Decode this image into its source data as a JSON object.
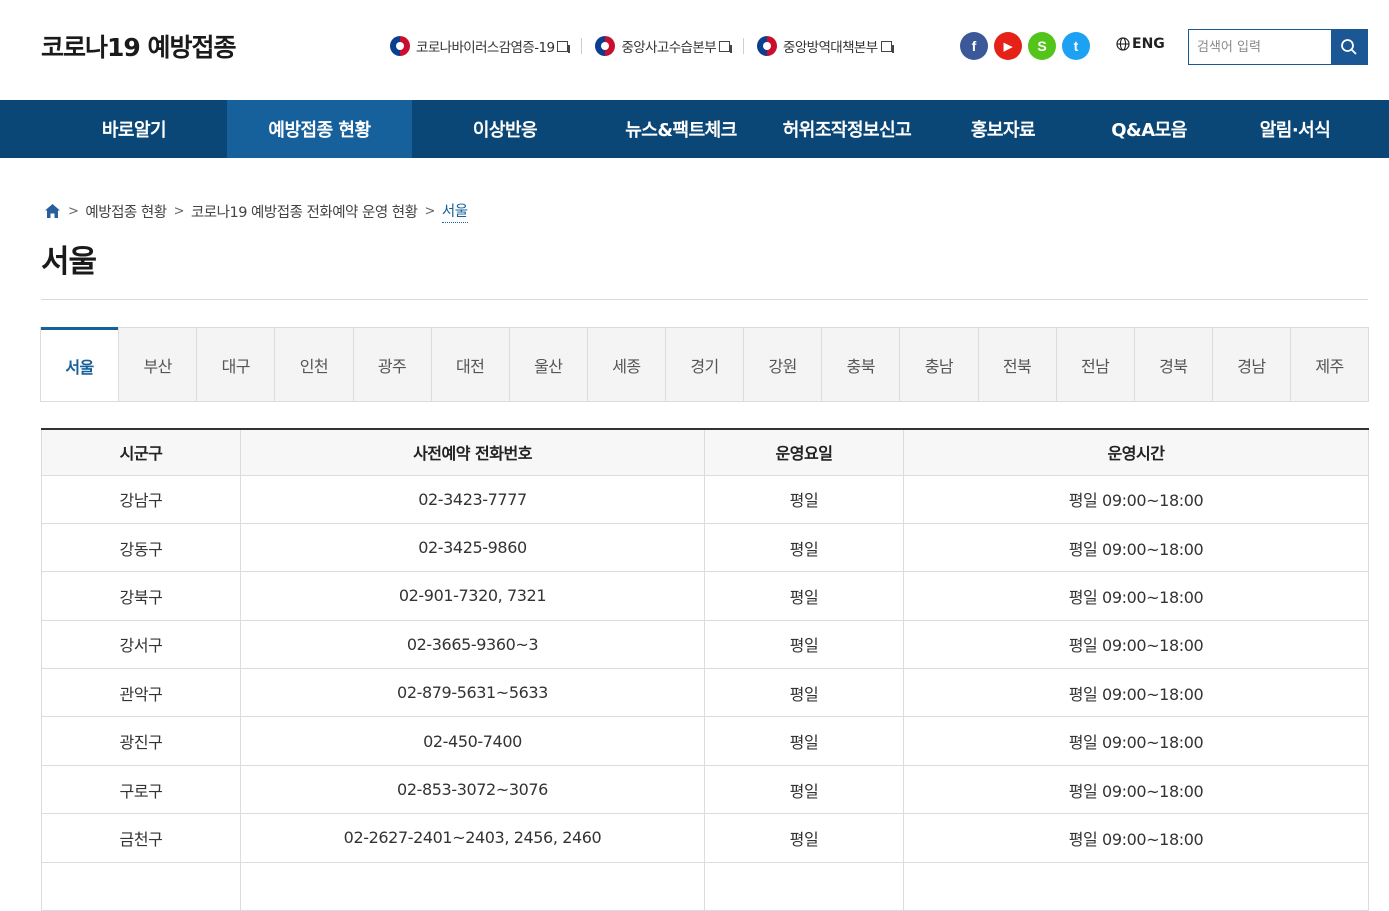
{
  "header": {
    "logo": "코로나19 예방접종",
    "util_links": [
      {
        "label": "코로나바이러스감염증-19"
      },
      {
        "label": "중앙사고수습본부"
      },
      {
        "label": "중앙방역대책본부"
      }
    ],
    "sns": [
      {
        "name": "facebook",
        "glyph": "f",
        "color": "#3b5998"
      },
      {
        "name": "youtube",
        "glyph": "▶",
        "color": "#e62117"
      },
      {
        "name": "kakaostory",
        "glyph": "S",
        "color": "#52c41a"
      },
      {
        "name": "twitter",
        "glyph": "t",
        "color": "#1da1f2"
      }
    ],
    "eng_label": "ENG",
    "search_placeholder": "검색어 입력"
  },
  "gnb": {
    "items": [
      {
        "label": "바로알기"
      },
      {
        "label": "예방접종 현황"
      },
      {
        "label": "이상반응"
      },
      {
        "label": "뉴스&팩트체크"
      },
      {
        "label": "허위조작정보신고"
      },
      {
        "label": "홍보자료"
      },
      {
        "label": "Q&A모음"
      },
      {
        "label": "알림·서식"
      }
    ],
    "active_index": 1
  },
  "breadcrumb": {
    "items": [
      "예방접종 현황",
      "코로나19 예방접종 전화예약 운영 현황"
    ],
    "current": "서울"
  },
  "page_title": "서울",
  "tabs": {
    "items": [
      "서울",
      "부산",
      "대구",
      "인천",
      "광주",
      "대전",
      "울산",
      "세종",
      "경기",
      "강원",
      "충북",
      "충남",
      "전북",
      "전남",
      "경북",
      "경남",
      "제주"
    ],
    "active_index": 0
  },
  "table": {
    "headers": [
      "시군구",
      "사전예약 전화번호",
      "운영요일",
      "운영시간"
    ],
    "rows": [
      [
        "강남구",
        "02-3423-7777",
        "평일",
        "평일 09:00~18:00"
      ],
      [
        "강동구",
        "02-3425-9860",
        "평일",
        "평일 09:00~18:00"
      ],
      [
        "강북구",
        "02-901-7320, 7321",
        "평일",
        "평일 09:00~18:00"
      ],
      [
        "강서구",
        "02-3665-9360~3",
        "평일",
        "평일 09:00~18:00"
      ],
      [
        "관악구",
        "02-879-5631~5633",
        "평일",
        "평일 09:00~18:00"
      ],
      [
        "광진구",
        "02-450-7400",
        "평일",
        "평일 09:00~18:00"
      ],
      [
        "구로구",
        "02-853-3072~3076",
        "평일",
        "평일 09:00~18:00"
      ],
      [
        "금천구",
        "02-2627-2401~2403, 2456, 2460",
        "평일",
        "평일 09:00~18:00"
      ],
      [
        "",
        "",
        "",
        ""
      ]
    ]
  }
}
